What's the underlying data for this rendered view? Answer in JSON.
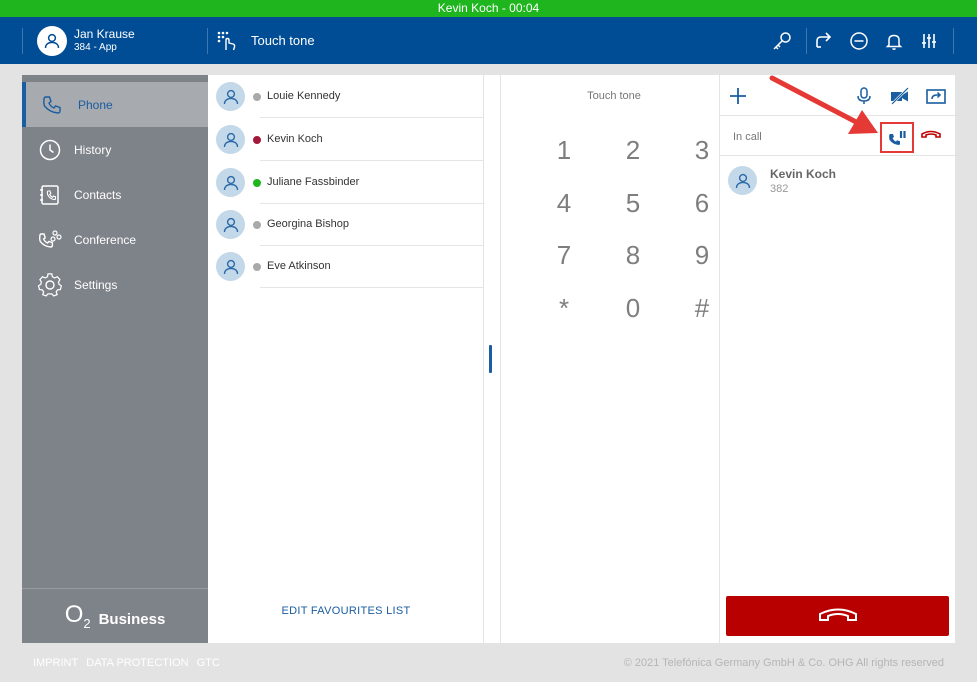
{
  "call_bar": {
    "text": "Kevin Koch - 00:04"
  },
  "header": {
    "user_name": "Jan Krause",
    "user_sub": "384 - App",
    "touch_label": "Touch tone"
  },
  "sidebar": {
    "items": [
      {
        "label": "Phone",
        "icon": "phone-icon"
      },
      {
        "label": "History",
        "icon": "clock-icon"
      },
      {
        "label": "Contacts",
        "icon": "contacts-icon"
      },
      {
        "label": "Conference",
        "icon": "conference-icon"
      },
      {
        "label": "Settings",
        "icon": "gear-icon"
      }
    ],
    "logo_o2": "O",
    "logo_sub": "2",
    "logo_biz": "Business"
  },
  "favorites": {
    "items": [
      {
        "name": "Louie Kennedy",
        "status_color": "#a9a9a9"
      },
      {
        "name": "Kevin Koch",
        "status_color": "#a3173a"
      },
      {
        "name": "Juliane Fassbinder",
        "status_color": "#1fb51f"
      },
      {
        "name": "Georgina Bishop",
        "status_color": "#a9a9a9"
      },
      {
        "name": "Eve Atkinson",
        "status_color": "#a9a9a9"
      }
    ],
    "edit_label": "EDIT FAVOURITES LIST"
  },
  "keypad": {
    "title": "Touch tone",
    "keys": [
      "1",
      "2",
      "3",
      "4",
      "5",
      "6",
      "7",
      "8",
      "9",
      "*",
      "0",
      "#"
    ]
  },
  "call_panel": {
    "status": "In call",
    "caller_name": "Kevin Koch",
    "caller_ext": "382"
  },
  "footer": {
    "links": [
      "IMPRINT",
      "DATA PROTECTION",
      "GTC"
    ],
    "copyright": "© 2021 Telefónica Germany GmbH & Co. OHG All rights reserved"
  },
  "colors": {
    "brand_blue": "#004d95",
    "call_green": "#1fb51f",
    "hangup_red": "#b80000",
    "highlight_red": "#e53935"
  }
}
